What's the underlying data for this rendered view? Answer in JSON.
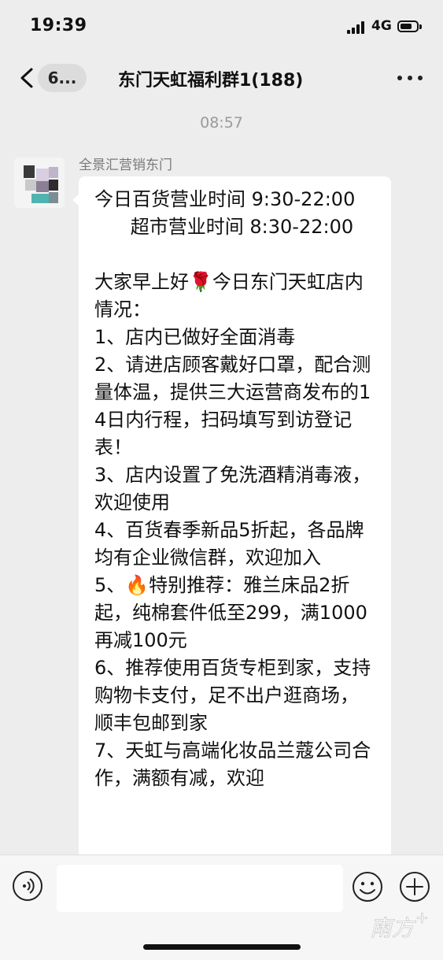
{
  "status_bar": {
    "time": "19:39",
    "network": "4G",
    "icons": [
      "signal-icon",
      "battery-icon"
    ]
  },
  "nav": {
    "back_count": "6...",
    "title": "东门天虹福利群1(188)",
    "icons": [
      "back-arrow-icon",
      "more-icon"
    ]
  },
  "chat": {
    "timestamp": "08:57",
    "message": {
      "sender": "全景汇营销东门",
      "text": "今日百货营业时间 9:30-22:00\n      超市营业时间 8:30-22:00\n\n大家早上好🌹今日东门天虹店内情况：\n1、店内已做好全面消毒\n2、请进店顾客戴好口罩，配合测量体温，提供三大运营商发布的14日内行程，扫码填写到访登记表！\n3、店内设置了免洗酒精消毒液，欢迎使用\n4、百货春季新品5折起，各品牌均有企业微信群，欢迎加入\n5、🔥特别推荐：雅兰床品2折起，纯棉套件低至299，满1000再减100元\n6、推荐使用百货专柜到家，支持购物卡支付，足不出户逛商场，顺丰包邮到家\n7、天虹与高端化妆品兰蔻公司合作，满额有减，欢迎"
    }
  },
  "input_bar": {
    "placeholder": "",
    "icons": [
      "voice-icon",
      "emoji-icon",
      "plus-icon"
    ]
  },
  "watermark": {
    "text": "南方+"
  },
  "colors": {
    "background": "#ededed",
    "bubble": "#ffffff",
    "timestamp": "#9a9a9a"
  }
}
